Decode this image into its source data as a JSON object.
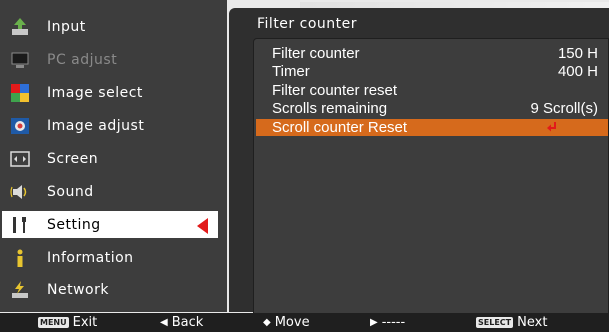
{
  "menu": {
    "items": [
      {
        "label": "Input",
        "icon": "input-icon"
      },
      {
        "label": "PC adjust",
        "icon": "pc-adjust-icon"
      },
      {
        "label": "Image select",
        "icon": "image-select-icon"
      },
      {
        "label": "Image adjust",
        "icon": "image-adjust-icon"
      },
      {
        "label": "Screen",
        "icon": "screen-icon"
      },
      {
        "label": "Sound",
        "icon": "sound-icon"
      },
      {
        "label": "Setting",
        "icon": "setting-icon"
      },
      {
        "label": "Information",
        "icon": "information-icon"
      },
      {
        "label": "Network",
        "icon": "network-icon"
      }
    ],
    "active_index": 6,
    "disabled_index": 1
  },
  "panel": {
    "title": "Filter counter",
    "rows": [
      {
        "label": "Filter counter",
        "value": "150 H"
      },
      {
        "label": "Timer",
        "value": "400 H"
      },
      {
        "label": "Filter counter reset",
        "value": ""
      },
      {
        "label": "Scrolls remaining",
        "value": "9 Scroll(s)"
      },
      {
        "label": "Scroll counter Reset",
        "value": ""
      }
    ],
    "selected_index": 4
  },
  "bottombar": {
    "exit_key": "MENU",
    "exit_label": "Exit",
    "back_label": "Back",
    "move_label": "Move",
    "dashes": "-----",
    "next_key": "SELECT",
    "next_label": "Next"
  },
  "colors": {
    "accent": "#d66a1c",
    "arrow": "#e21a1a",
    "panel_bg": "#3d3d3d"
  }
}
